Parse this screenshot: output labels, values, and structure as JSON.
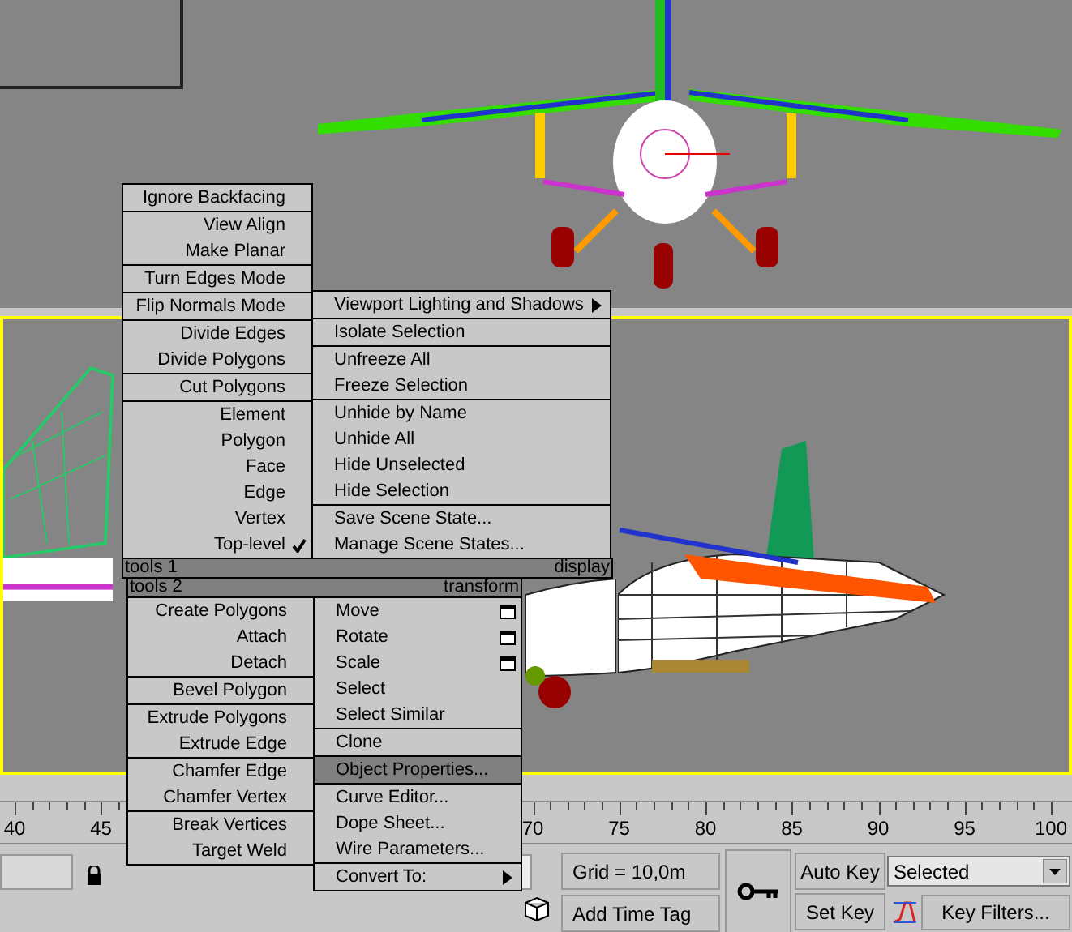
{
  "quad_menu": {
    "quadrants": [
      {
        "title": "tools 1",
        "groups": [
          [
            {
              "label": "Ignore Backfacing",
              "kind": "plain",
              "checked": false,
              "selected": false
            }
          ],
          [
            {
              "label": "View Align",
              "kind": "plain",
              "checked": false,
              "selected": false
            },
            {
              "label": "Make Planar",
              "kind": "plain",
              "checked": false,
              "selected": false
            }
          ],
          [
            {
              "label": "Turn Edges Mode",
              "kind": "plain",
              "checked": false,
              "selected": false
            }
          ],
          [
            {
              "label": "Flip Normals Mode",
              "kind": "plain",
              "checked": false,
              "selected": false
            }
          ],
          [
            {
              "label": "Divide Edges",
              "kind": "plain",
              "checked": false,
              "selected": false
            },
            {
              "label": "Divide Polygons",
              "kind": "plain",
              "checked": false,
              "selected": false
            }
          ],
          [
            {
              "label": "Cut Polygons",
              "kind": "plain",
              "checked": false,
              "selected": false
            }
          ],
          [
            {
              "label": "Element",
              "kind": "plain",
              "checked": false,
              "selected": false
            },
            {
              "label": "Polygon",
              "kind": "plain",
              "checked": false,
              "selected": false
            },
            {
              "label": "Face",
              "kind": "plain",
              "checked": false,
              "selected": false
            },
            {
              "label": "Edge",
              "kind": "plain",
              "checked": false,
              "selected": false
            },
            {
              "label": "Vertex",
              "kind": "plain",
              "checked": false,
              "selected": false
            },
            {
              "label": "Top-level",
              "kind": "plain",
              "checked": true,
              "selected": false
            }
          ]
        ]
      },
      {
        "title": "display",
        "groups": [
          [
            {
              "label": "Viewport Lighting and Shadows",
              "kind": "submenu",
              "checked": false,
              "selected": false
            }
          ],
          [
            {
              "label": "Isolate Selection",
              "kind": "plain",
              "checked": false,
              "selected": false
            }
          ],
          [
            {
              "label": "Unfreeze All",
              "kind": "plain",
              "checked": false,
              "selected": false
            },
            {
              "label": "Freeze Selection",
              "kind": "plain",
              "checked": false,
              "selected": false
            }
          ],
          [
            {
              "label": "Unhide by Name",
              "kind": "plain",
              "checked": false,
              "selected": false
            },
            {
              "label": "Unhide All",
              "kind": "plain",
              "checked": false,
              "selected": false
            },
            {
              "label": "Hide Unselected",
              "kind": "plain",
              "checked": false,
              "selected": false
            },
            {
              "label": "Hide Selection",
              "kind": "plain",
              "checked": false,
              "selected": false
            }
          ],
          [
            {
              "label": "Save Scene State...",
              "kind": "plain",
              "checked": false,
              "selected": false
            },
            {
              "label": "Manage Scene States...",
              "kind": "plain",
              "checked": false,
              "selected": false
            }
          ]
        ]
      },
      {
        "title": "tools 2",
        "groups": [
          [
            {
              "label": "Create Polygons",
              "kind": "plain",
              "checked": false,
              "selected": false
            },
            {
              "label": "Attach",
              "kind": "plain",
              "checked": false,
              "selected": false
            },
            {
              "label": "Detach",
              "kind": "plain",
              "checked": false,
              "selected": false
            }
          ],
          [
            {
              "label": "Bevel Polygon",
              "kind": "plain",
              "checked": false,
              "selected": false
            }
          ],
          [
            {
              "label": "Extrude Polygons",
              "kind": "plain",
              "checked": false,
              "selected": false
            },
            {
              "label": "Extrude Edge",
              "kind": "plain",
              "checked": false,
              "selected": false
            }
          ],
          [
            {
              "label": "Chamfer Edge",
              "kind": "plain",
              "checked": false,
              "selected": false
            },
            {
              "label": "Chamfer Vertex",
              "kind": "plain",
              "checked": false,
              "selected": false
            }
          ],
          [
            {
              "label": "Break Vertices",
              "kind": "plain",
              "checked": false,
              "selected": false
            },
            {
              "label": "Target Weld",
              "kind": "plain",
              "checked": false,
              "selected": false
            }
          ]
        ]
      },
      {
        "title": "transform",
        "groups": [
          [
            {
              "label": "Move",
              "kind": "options",
              "checked": false,
              "selected": false
            },
            {
              "label": "Rotate",
              "kind": "options",
              "checked": false,
              "selected": false
            },
            {
              "label": "Scale",
              "kind": "options",
              "checked": false,
              "selected": false
            },
            {
              "label": "Select",
              "kind": "plain",
              "checked": false,
              "selected": false
            },
            {
              "label": "Select Similar",
              "kind": "plain",
              "checked": false,
              "selected": false
            }
          ],
          [
            {
              "label": "Clone",
              "kind": "plain",
              "checked": false,
              "selected": false
            }
          ],
          [
            {
              "label": "Object Properties...",
              "kind": "plain",
              "checked": false,
              "selected": true
            }
          ],
          [
            {
              "label": "Curve Editor...",
              "kind": "plain",
              "checked": false,
              "selected": false
            },
            {
              "label": "Dope Sheet...",
              "kind": "plain",
              "checked": false,
              "selected": false
            },
            {
              "label": "Wire Parameters...",
              "kind": "plain",
              "checked": false,
              "selected": false
            }
          ],
          [
            {
              "label": "Convert To:",
              "kind": "submenu",
              "checked": false,
              "selected": false
            }
          ]
        ]
      }
    ]
  },
  "timeline": {
    "labels": [
      "40",
      "45",
      "70",
      "75",
      "80",
      "85",
      "90",
      "95",
      "100"
    ]
  },
  "status": {
    "grid": "Grid = 10,0m",
    "time_tag": "Add Time Tag"
  },
  "key_controls": {
    "auto_key": "Auto Key",
    "set_key": "Set Key",
    "selection_dropdown": "Selected",
    "key_filters": "Key Filters..."
  }
}
